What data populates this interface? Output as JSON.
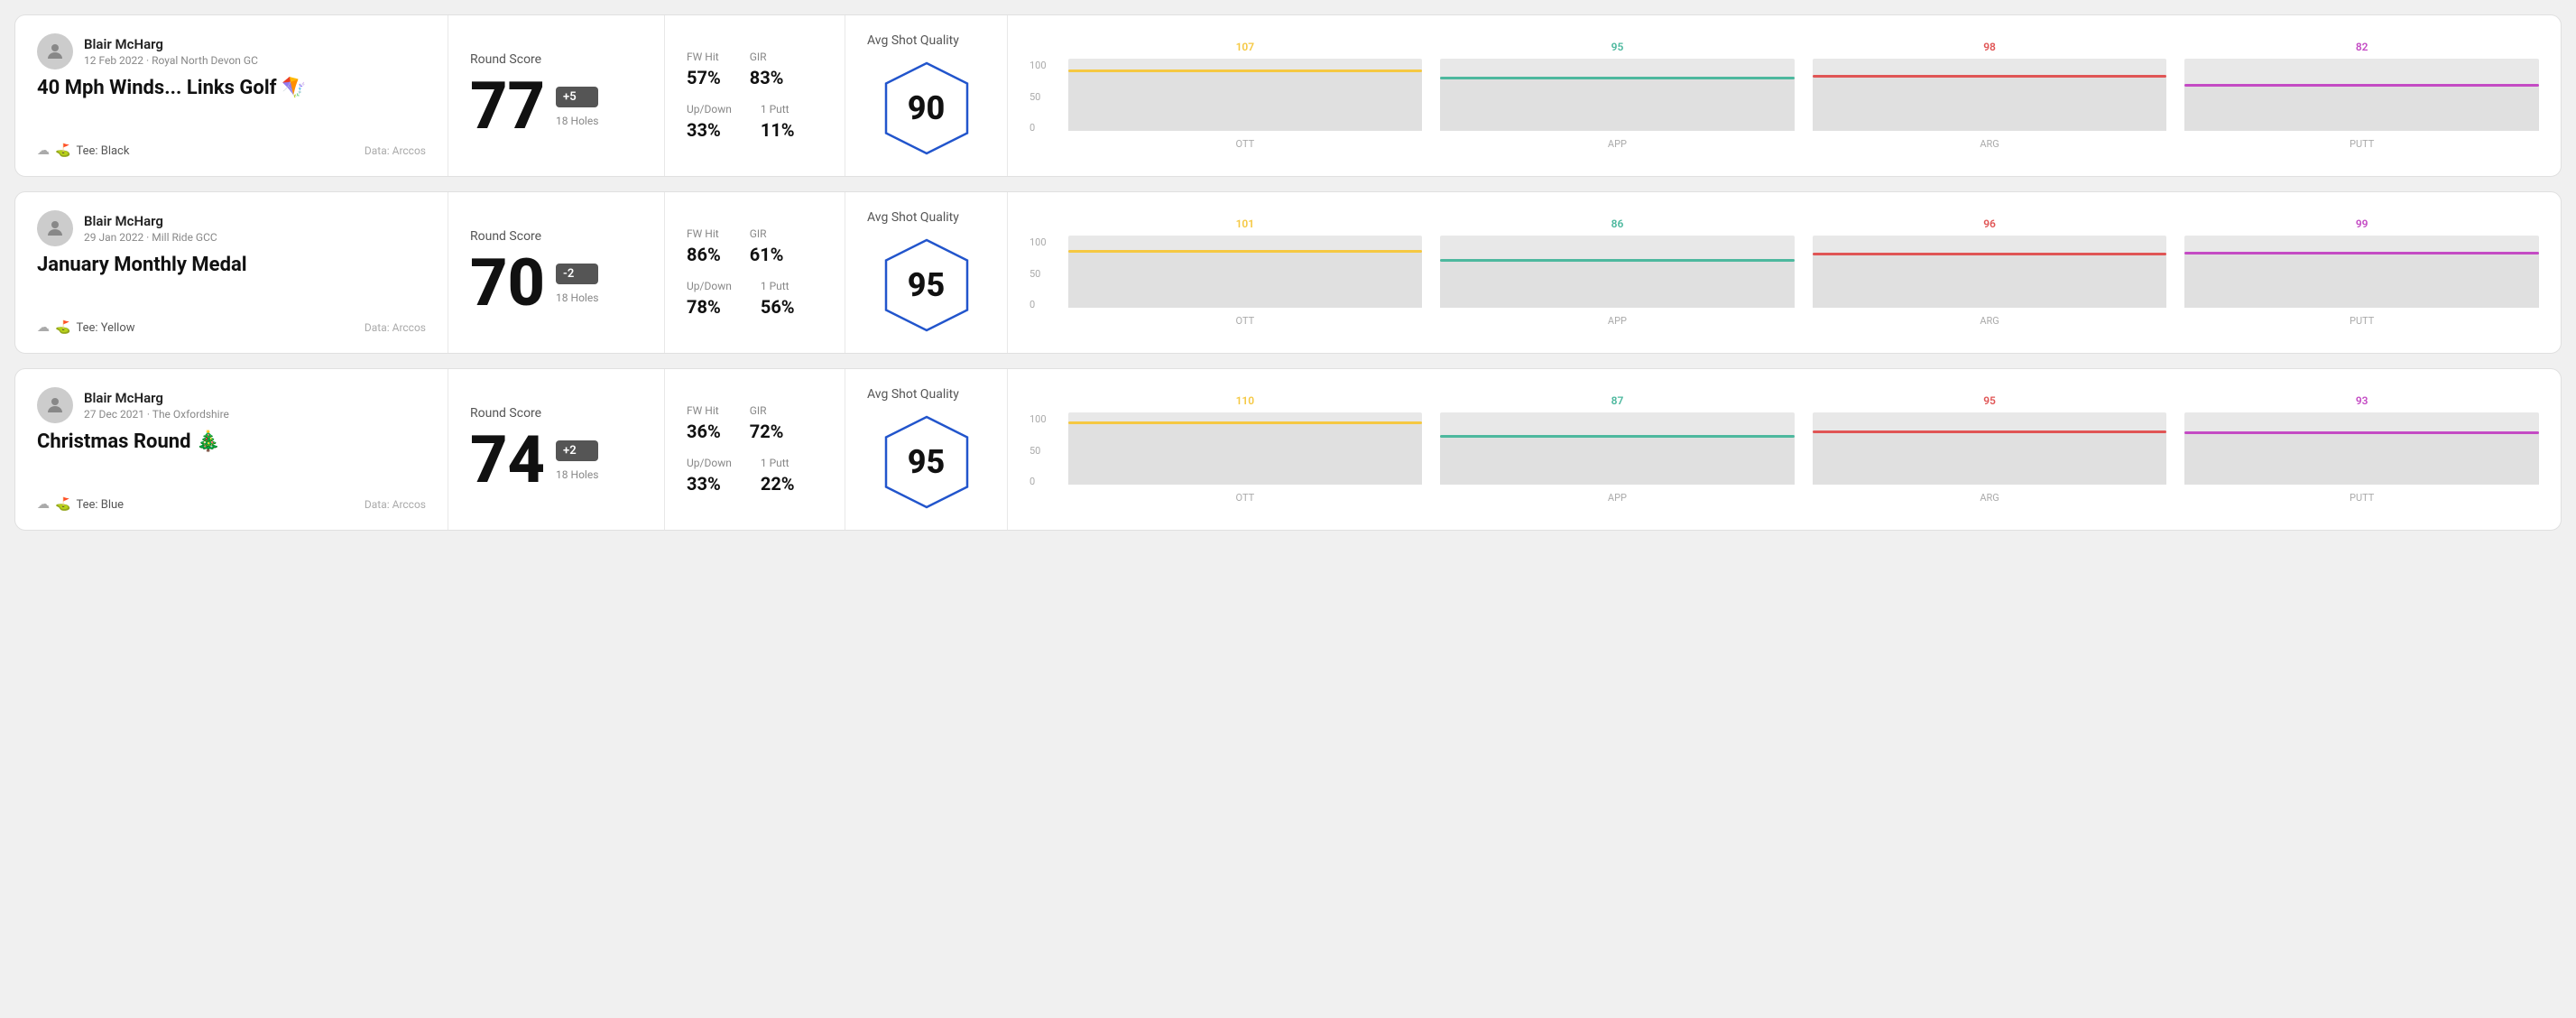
{
  "rounds": [
    {
      "id": "round-1",
      "user": {
        "name": "Blair McHarg",
        "date": "12 Feb 2022",
        "course": "Royal North Devon GC"
      },
      "title": "40 Mph Winds... Links Golf 🪁",
      "tee": "Black",
      "data_source": "Data: Arccos",
      "score": {
        "label": "Round Score",
        "number": "77",
        "badge": "+5",
        "holes": "18 Holes"
      },
      "stats": {
        "fw_hit_label": "FW Hit",
        "fw_hit_value": "57%",
        "gir_label": "GIR",
        "gir_value": "83%",
        "updown_label": "Up/Down",
        "updown_value": "33%",
        "oneputt_label": "1 Putt",
        "oneputt_value": "11%"
      },
      "quality": {
        "label": "Avg Shot Quality",
        "score": "90"
      },
      "chart": {
        "bars": [
          {
            "label": "OTT",
            "value": 107,
            "color": "#f5c842",
            "pct": 85
          },
          {
            "label": "APP",
            "value": 95,
            "color": "#4db89e",
            "pct": 75
          },
          {
            "label": "ARG",
            "value": 98,
            "color": "#e05555",
            "pct": 78
          },
          {
            "label": "PUTT",
            "value": 82,
            "color": "#c44bc4",
            "pct": 65
          }
        ],
        "y_labels": [
          "100",
          "50",
          "0"
        ]
      }
    },
    {
      "id": "round-2",
      "user": {
        "name": "Blair McHarg",
        "date": "29 Jan 2022",
        "course": "Mill Ride GCC"
      },
      "title": "January Monthly Medal",
      "tee": "Yellow",
      "data_source": "Data: Arccos",
      "score": {
        "label": "Round Score",
        "number": "70",
        "badge": "-2",
        "holes": "18 Holes"
      },
      "stats": {
        "fw_hit_label": "FW Hit",
        "fw_hit_value": "86%",
        "gir_label": "GIR",
        "gir_value": "61%",
        "updown_label": "Up/Down",
        "updown_value": "78%",
        "oneputt_label": "1 Putt",
        "oneputt_value": "56%"
      },
      "quality": {
        "label": "Avg Shot Quality",
        "score": "95"
      },
      "chart": {
        "bars": [
          {
            "label": "OTT",
            "value": 101,
            "color": "#f5c842",
            "pct": 80
          },
          {
            "label": "APP",
            "value": 86,
            "color": "#4db89e",
            "pct": 68
          },
          {
            "label": "ARG",
            "value": 96,
            "color": "#e05555",
            "pct": 76
          },
          {
            "label": "PUTT",
            "value": 99,
            "color": "#c44bc4",
            "pct": 78
          }
        ],
        "y_labels": [
          "100",
          "50",
          "0"
        ]
      }
    },
    {
      "id": "round-3",
      "user": {
        "name": "Blair McHarg",
        "date": "27 Dec 2021",
        "course": "The Oxfordshire"
      },
      "title": "Christmas Round 🎄",
      "tee": "Blue",
      "data_source": "Data: Arccos",
      "score": {
        "label": "Round Score",
        "number": "74",
        "badge": "+2",
        "holes": "18 Holes"
      },
      "stats": {
        "fw_hit_label": "FW Hit",
        "fw_hit_value": "36%",
        "gir_label": "GIR",
        "gir_value": "72%",
        "updown_label": "Up/Down",
        "updown_value": "33%",
        "oneputt_label": "1 Putt",
        "oneputt_value": "22%"
      },
      "quality": {
        "label": "Avg Shot Quality",
        "score": "95"
      },
      "chart": {
        "bars": [
          {
            "label": "OTT",
            "value": 110,
            "color": "#f5c842",
            "pct": 88
          },
          {
            "label": "APP",
            "value": 87,
            "color": "#4db89e",
            "pct": 69
          },
          {
            "label": "ARG",
            "value": 95,
            "color": "#e05555",
            "pct": 75
          },
          {
            "label": "PUTT",
            "value": 93,
            "color": "#c44bc4",
            "pct": 74
          }
        ],
        "y_labels": [
          "100",
          "50",
          "0"
        ]
      }
    }
  ]
}
